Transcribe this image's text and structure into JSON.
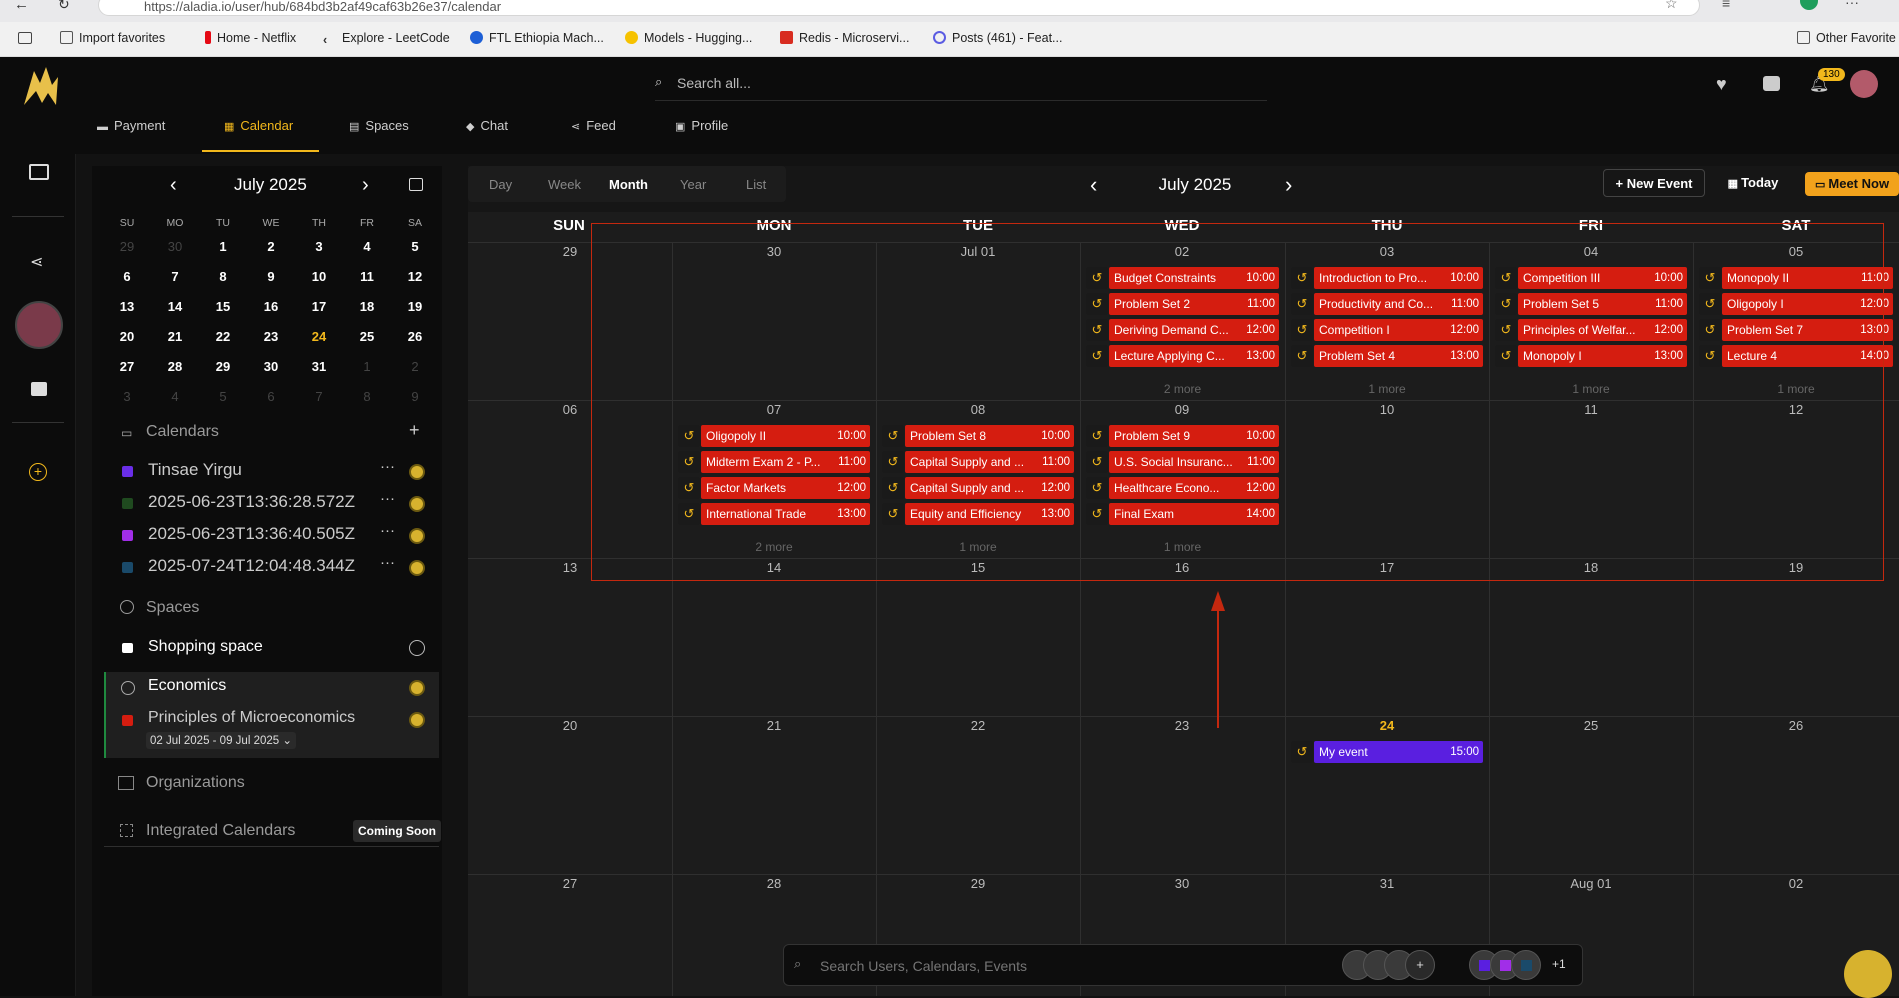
{
  "browser": {
    "url": "https://aladia.io/user/hub/684bd3b2af49caf63b26e37/calendar",
    "bookmarks": [
      "Import favorites",
      "Home - Netflix",
      "Explore - LeetCode",
      "FTL Ethiopia Mach...",
      "Models - Hugging...",
      "Redis - Microservi...",
      "Posts (461) - Feat..."
    ],
    "other_favorites": "Other Favorite"
  },
  "header": {
    "search_placeholder": "Search all...",
    "notification_count": "130",
    "tabs": [
      "Payment",
      "Calendar",
      "Spaces",
      "Chat",
      "Feed",
      "Profile"
    ],
    "active_tab": "Calendar"
  },
  "mini_calendar": {
    "title": "July 2025",
    "dow": [
      "SU",
      "MO",
      "TU",
      "WE",
      "TH",
      "FR",
      "SA"
    ],
    "weeks": [
      [
        "29",
        "30",
        "1",
        "2",
        "3",
        "4",
        "5"
      ],
      [
        "6",
        "7",
        "8",
        "9",
        "10",
        "11",
        "12"
      ],
      [
        "13",
        "14",
        "15",
        "16",
        "17",
        "18",
        "19"
      ],
      [
        "20",
        "21",
        "22",
        "23",
        "24",
        "25",
        "26"
      ],
      [
        "27",
        "28",
        "29",
        "30",
        "31",
        "1",
        "2"
      ],
      [
        "3",
        "4",
        "5",
        "6",
        "7",
        "8",
        "9"
      ]
    ],
    "today": "24"
  },
  "sidebar": {
    "calendars_title": "Calendars",
    "calendars": [
      {
        "name": "Tinsae Yirgu",
        "color": "#6a2ee8"
      },
      {
        "name": "2025-06-23T13:36:28.572Z",
        "color": "#1f4a1f"
      },
      {
        "name": "2025-06-23T13:36:40.505Z",
        "color": "#a12ee8"
      },
      {
        "name": "2025-07-24T12:04:48.344Z",
        "color": "#1a4a6a"
      }
    ],
    "spaces_title": "Spaces",
    "spaces": [
      {
        "name": "Shopping space"
      },
      {
        "name": "Economics"
      }
    ],
    "course": {
      "name": "Principles of Microeconomics",
      "dates": "02 Jul 2025 - 09 Jul 2025",
      "color": "#d51d10"
    },
    "organizations_title": "Organizations",
    "integrated_title": "Integrated Calendars",
    "coming_soon": "Coming Soon"
  },
  "toolbar": {
    "views": [
      "Day",
      "Week",
      "Month",
      "Year",
      "List"
    ],
    "active_view": "Month",
    "title": "July 2025",
    "new_event": "New Event",
    "today": "Today",
    "meet_now": "Meet Now"
  },
  "grid": {
    "dow": [
      "SUN",
      "MON",
      "TUE",
      "WED",
      "THU",
      "FRI",
      "SAT"
    ],
    "weeks": [
      [
        "29",
        "30",
        "Jul 01",
        "02",
        "03",
        "04",
        "05"
      ],
      [
        "06",
        "07",
        "08",
        "09",
        "10",
        "11",
        "12"
      ],
      [
        "13",
        "14",
        "15",
        "16",
        "17",
        "18",
        "19"
      ],
      [
        "20",
        "21",
        "22",
        "23",
        "24",
        "25",
        "26"
      ],
      [
        "27",
        "28",
        "29",
        "30",
        "31",
        "Aug 01",
        "02"
      ]
    ],
    "today_label": "24"
  },
  "events": {
    "w0_wed": [
      [
        "Budget Constraints",
        "10:00"
      ],
      [
        "Problem Set 2",
        "11:00"
      ],
      [
        "Deriving Demand C...",
        "12:00"
      ],
      [
        "Lecture Applying C...",
        "13:00"
      ]
    ],
    "w0_thu": [
      [
        "Introduction to Pro...",
        "10:00"
      ],
      [
        "Productivity and Co...",
        "11:00"
      ],
      [
        "Competition I",
        "12:00"
      ],
      [
        "Problem Set 4",
        "13:00"
      ]
    ],
    "w0_fri": [
      [
        "Competition III",
        "10:00"
      ],
      [
        "Problem Set 5",
        "11:00"
      ],
      [
        "Principles of Welfar...",
        "12:00"
      ],
      [
        "Monopoly I",
        "13:00"
      ]
    ],
    "w0_sat": [
      [
        "Monopoly II",
        "11:00"
      ],
      [
        "Oligopoly I",
        "12:00"
      ],
      [
        "Problem Set 7",
        "13:00"
      ],
      [
        "Lecture 4",
        "14:00"
      ]
    ],
    "w1_mon": [
      [
        "Oligopoly II",
        "10:00"
      ],
      [
        "Midterm Exam 2 - P...",
        "11:00"
      ],
      [
        "Factor Markets",
        "12:00"
      ],
      [
        "International Trade",
        "13:00"
      ]
    ],
    "w1_tue": [
      [
        "Problem Set 8",
        "10:00"
      ],
      [
        "Capital Supply and ...",
        "11:00"
      ],
      [
        "Capital Supply and ...",
        "12:00"
      ],
      [
        "Equity and Efficiency",
        "13:00"
      ]
    ],
    "w1_wed": [
      [
        "Problem Set 9",
        "10:00"
      ],
      [
        "U.S. Social Insuranc...",
        "11:00"
      ],
      [
        "Healthcare Econo...",
        "12:00"
      ],
      [
        "Final Exam",
        "14:00"
      ]
    ],
    "w3_thu": [
      [
        "My event",
        "15:00"
      ]
    ],
    "more": {
      "w0_wed": "2 more",
      "w0_thu": "1 more",
      "w0_fri": "1 more",
      "w0_sat": "1 more",
      "w1_mon": "2 more",
      "w1_tue": "1 more",
      "w1_wed": "1 more"
    }
  },
  "bottom_bar": {
    "placeholder": "Search Users, Calendars, Events",
    "extra": "+1"
  }
}
